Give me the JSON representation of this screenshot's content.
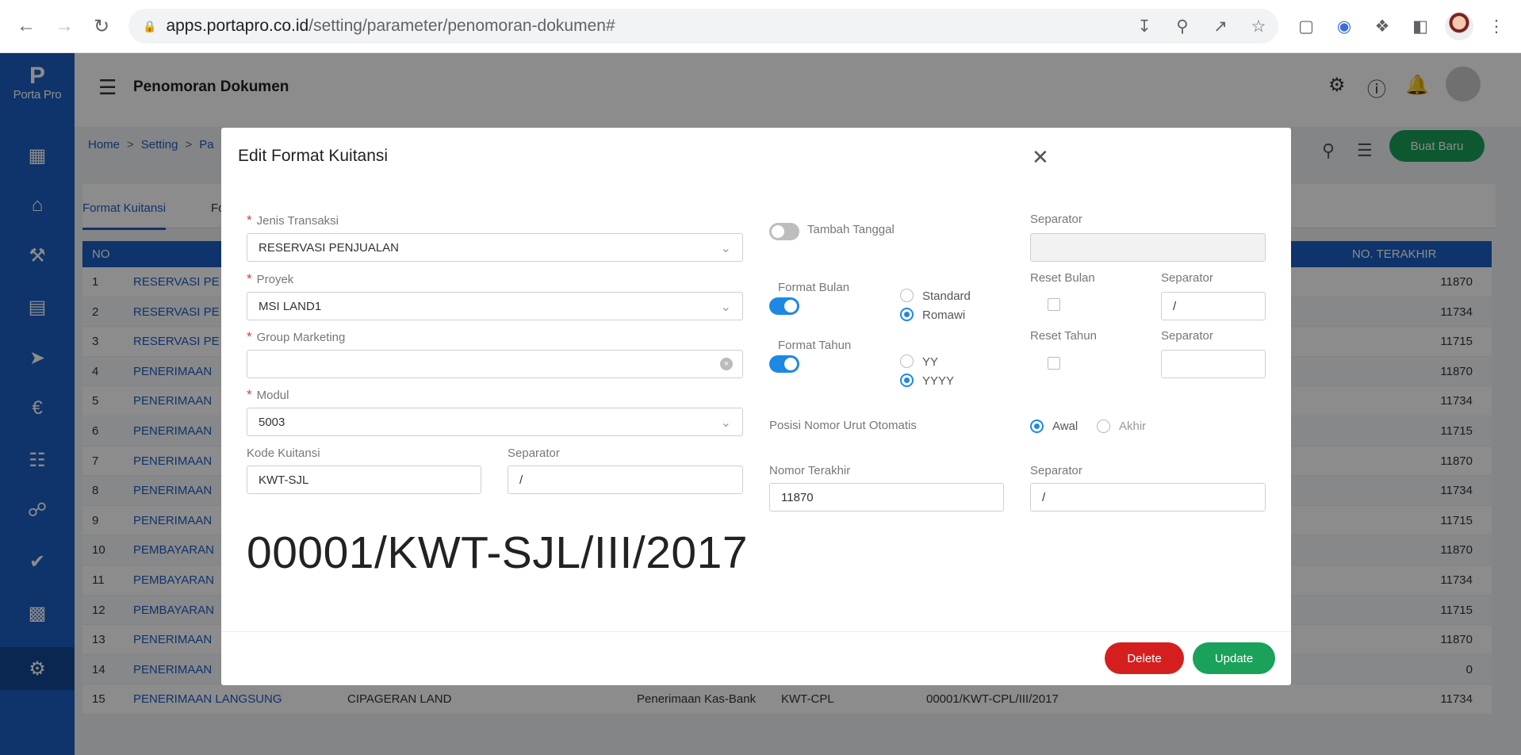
{
  "browser": {
    "url_domain": "apps.portapro.co.id",
    "url_path": "/setting/parameter/penomoran-dokumen#"
  },
  "sidebar": {
    "logo_mark": "P",
    "logo_text": "Porta Pro",
    "items": [
      "dashboard",
      "house",
      "tools",
      "clipboard",
      "rocket",
      "finance",
      "report",
      "cake",
      "badge",
      "chart",
      "settings"
    ]
  },
  "header": {
    "title": "Penomoran Dokumen"
  },
  "breadcrumb": {
    "home": "Home",
    "setting": "Setting",
    "current": "Pa"
  },
  "toolbar": {
    "new_label": "Buat Baru"
  },
  "tabs": {
    "tab1": "Format Kuitansi",
    "tab2": "For"
  },
  "table": {
    "headers": {
      "no": "NO",
      "last": "NO. TERAKHIR"
    },
    "rows": [
      {
        "no": "1",
        "name": "RESERVASI PE",
        "last": "11870"
      },
      {
        "no": "2",
        "name": "RESERVASI PE",
        "last": "11734"
      },
      {
        "no": "3",
        "name": "RESERVASI PE",
        "last": "11715"
      },
      {
        "no": "4",
        "name": "PENERIMAAN",
        "last": "11870"
      },
      {
        "no": "5",
        "name": "PENERIMAAN",
        "last": "11734"
      },
      {
        "no": "6",
        "name": "PENERIMAAN",
        "last": "11715"
      },
      {
        "no": "7",
        "name": "PENERIMAAN",
        "last": "11870"
      },
      {
        "no": "8",
        "name": "PENERIMAAN",
        "last": "11734"
      },
      {
        "no": "9",
        "name": "PENERIMAAN",
        "last": "11715"
      },
      {
        "no": "10",
        "name": "PEMBAYARAN",
        "last": "11870"
      },
      {
        "no": "11",
        "name": "PEMBAYARAN",
        "last": "11734"
      },
      {
        "no": "12",
        "name": "PEMBAYARAN",
        "last": "11715"
      },
      {
        "no": "13",
        "name": "PENERIMAAN",
        "last": "11870"
      },
      {
        "no": "14",
        "name": "PENERIMAAN",
        "last": "0"
      },
      {
        "no": "15",
        "name": "PENERIMAAN LANGSUNG",
        "project": "CIPAGERAN LAND",
        "modul": "Penerimaan Kas-Bank",
        "code": "KWT-CPL",
        "format": "00001/KWT-CPL/III/2017",
        "last": "11734"
      }
    ]
  },
  "modal": {
    "title": "Edit Format Kuitansi",
    "jenis_label": "Jenis Transaksi",
    "jenis_value": "RESERVASI PENJUALAN",
    "proyek_label": "Proyek",
    "proyek_value": "MSI LAND1",
    "group_label": "Group Marketing",
    "group_value": "",
    "modul_label": "Modul",
    "modul_value": "5003",
    "kode_label": "Kode Kuitansi",
    "kode_value": "KWT-SJL",
    "sep1_label": "Separator",
    "sep1_value": "/",
    "tambah_label": "Tambah Tanggal",
    "tambah_on": false,
    "sep_tgl_label": "Separator",
    "bulan_label": "Format Bulan",
    "bulan_on": true,
    "bulan_standard": "Standard",
    "bulan_romawi": "Romawi",
    "reset_bulan_label": "Reset Bulan",
    "sep_bulan_label": "Separator",
    "sep_bulan_value": "/",
    "tahun_label": "Format Tahun",
    "tahun_on": true,
    "tahun_yy": "YY",
    "tahun_yyyy": "YYYY",
    "reset_tahun_label": "Reset Tahun",
    "sep_tahun_label": "Separator",
    "sep_tahun_value": "",
    "posisi_label": "Posisi Nomor Urut Otomatis",
    "posisi_awal": "Awal",
    "posisi_akhir": "Akhir",
    "nomor_label": "Nomor Terakhir",
    "nomor_value": "11870",
    "sep_nomor_label": "Separator",
    "sep_nomor_value": "/",
    "preview": "00001/KWT-SJL/III/2017",
    "delete_label": "Delete",
    "update_label": "Update"
  },
  "colors": {
    "primary": "#1c5ec4",
    "success": "#1aa15a",
    "danger": "#d51f1f",
    "toggle": "#1e88e5"
  }
}
